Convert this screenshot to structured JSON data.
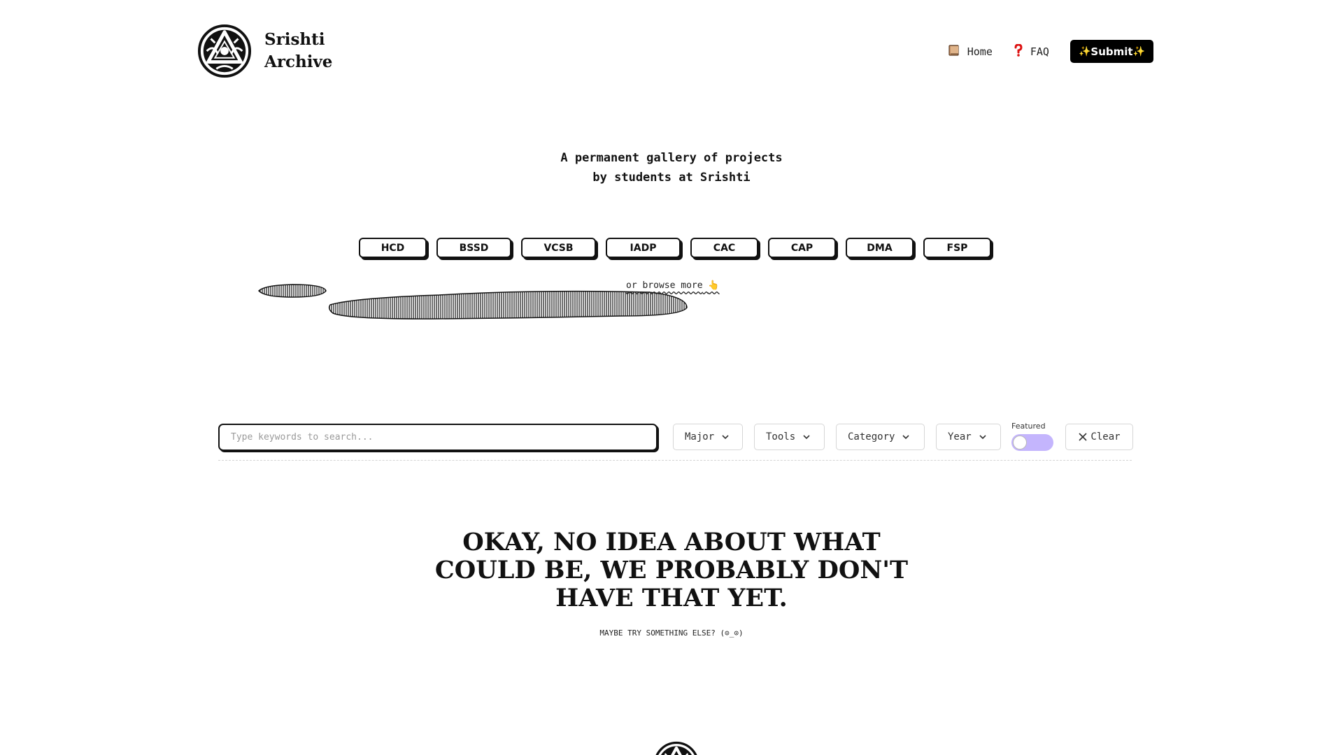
{
  "header": {
    "brand_line1": "Srishti",
    "brand_line2": "Archive",
    "logo_icon": "srishti-archive-logo-icon",
    "nav": {
      "home_label": "Home",
      "home_icon": "book-icon",
      "faq_label": "FAQ",
      "faq_icon": "question-mark-icon",
      "submit_label": "Submit",
      "submit_icon": "sparkles-icon"
    }
  },
  "hero": {
    "tagline_line1": "A permanent gallery of projects",
    "tagline_line2": "by students at Srishti",
    "majors": [
      "HCD",
      "BSSD",
      "VCSB",
      "IADP",
      "CAC",
      "CAP",
      "DMA",
      "FSP"
    ],
    "browse_more_label": "or browse more",
    "browse_more_icon": "pointing-finger-icon"
  },
  "filters": {
    "search_placeholder": "Type keywords to search...",
    "search_value": "",
    "major_label": "Major",
    "tools_label": "Tools",
    "category_label": "Category",
    "year_label": "Year",
    "featured_label": "Featured",
    "featured_on": false,
    "clear_label": "Clear",
    "accent_color": "#c4b5fd"
  },
  "empty_state": {
    "title_line1": "OKAY, NO IDEA ABOUT WHAT",
    "title_line2": "COULD BE, WE PROBABLY DON'T",
    "title_line3": "HAVE THAT YET.",
    "subtitle": "MAYBE TRY SOMETHING ELSE? (⊙_⊙)"
  }
}
